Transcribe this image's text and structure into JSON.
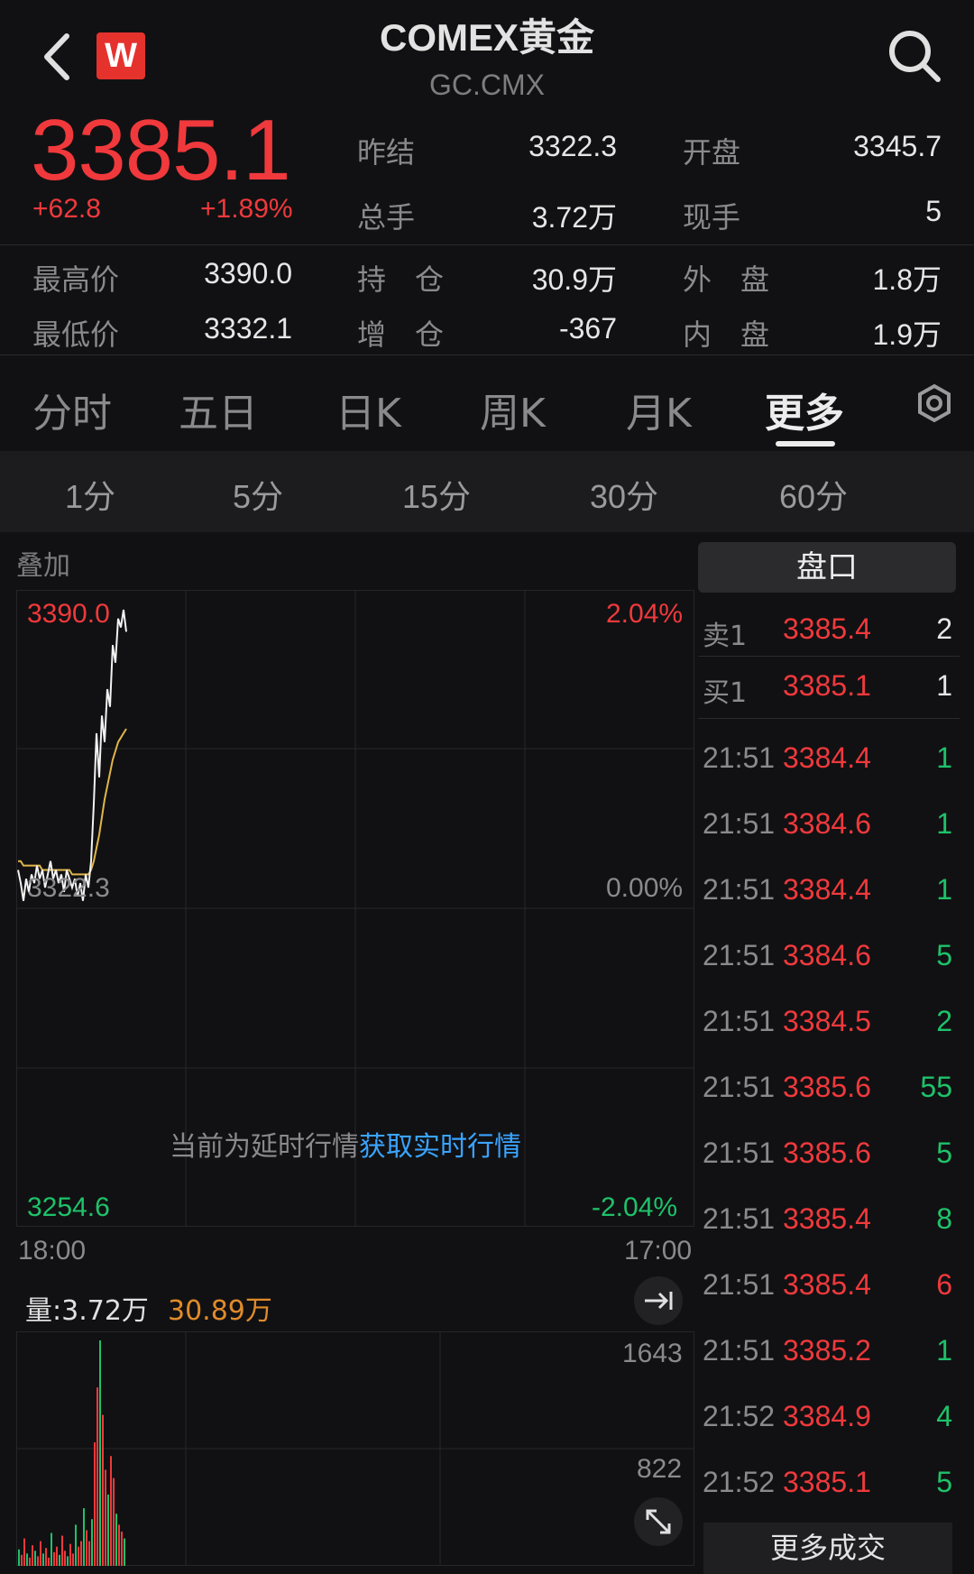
{
  "header": {
    "title": "COMEX黄金",
    "code": "GC.CMX",
    "logo_text": "W"
  },
  "quote": {
    "last": "3385.1",
    "change": "+62.8",
    "change_pct": "+1.89%",
    "stats": [
      {
        "label": "昨结",
        "value": "3322.3"
      },
      {
        "label": "开盘",
        "value": "3345.7"
      },
      {
        "label": "总手",
        "value": "3.72万"
      },
      {
        "label": "现手",
        "value": "5"
      },
      {
        "label": "最高价",
        "value": "3390.0"
      },
      {
        "label": "持　仓",
        "value": "30.9万"
      },
      {
        "label": "外　盘",
        "value": "1.8万"
      },
      {
        "label": "最低价",
        "value": "3332.1"
      },
      {
        "label": "增　仓",
        "value": "-367"
      },
      {
        "label": "内　盘",
        "value": "1.9万"
      }
    ]
  },
  "tabs": [
    "分时",
    "五日",
    "日K",
    "周K",
    "月K",
    "更多"
  ],
  "active_tab": "更多",
  "subtabs": [
    "1分",
    "5分",
    "15分",
    "30分",
    "60分"
  ],
  "chart": {
    "overlay_label": "叠加",
    "y_high": "3390.0",
    "y_mid": "3322.3",
    "y_low": "3254.6",
    "pct_high": "2.04%",
    "pct_mid": "0.00%",
    "pct_low": "-2.04%",
    "x_start": "18:00",
    "x_end": "17:00",
    "delay_notice": "当前为延时行情",
    "delay_link": "获取实时行情",
    "volume_label": "量:3.72万",
    "open_interest": "30.89万",
    "vol_max": "1643",
    "vol_mid": "822"
  },
  "chart_data": {
    "type": "line",
    "title": "",
    "xlabel": "",
    "ylabel": "",
    "ylim": [
      3254.6,
      3390.0
    ],
    "x_ticks": [
      "18:00",
      "17:00"
    ],
    "series": [
      {
        "values": [
          3331,
          3328,
          3324,
          3329,
          3326,
          3330,
          3328,
          3332,
          3329,
          3331,
          3327,
          3330,
          3333,
          3329,
          3331,
          3328,
          3330,
          3326,
          3331,
          3329,
          3327,
          3329,
          3325,
          3328,
          3324,
          3330,
          3327,
          3333,
          3346,
          3362,
          3352,
          3366,
          3360,
          3372,
          3368,
          3382,
          3378,
          3388,
          3386,
          3390,
          3385
        ]
      },
      {
        "values": [
          3333,
          3333,
          3332,
          3332,
          3332,
          3332,
          3332,
          3332,
          3332,
          3331,
          3331,
          3331,
          3331,
          3331,
          3331,
          3331,
          3331,
          3331,
          3331,
          3331,
          3330,
          3330,
          3330,
          3330,
          3330,
          3330,
          3330,
          3331,
          3333,
          3336,
          3339,
          3343,
          3347,
          3350,
          3353,
          3356,
          3358,
          3360,
          3361,
          3362,
          3363
        ]
      }
    ]
  },
  "volume_data": [
    120,
    80,
    200,
    90,
    60,
    150,
    110,
    70,
    180,
    90,
    130,
    60,
    240,
    100,
    140,
    80,
    220,
    110,
    70,
    160,
    90,
    300,
    140,
    180,
    420,
    260,
    180,
    340,
    900,
    1300,
    1643,
    1100,
    700,
    520,
    800,
    640,
    380,
    300,
    250,
    200
  ],
  "orderbook": {
    "title": "盘口",
    "asks": [
      {
        "label": "卖1",
        "price": "3385.4",
        "qty": "2"
      }
    ],
    "bids": [
      {
        "label": "买1",
        "price": "3385.1",
        "qty": "1"
      }
    ]
  },
  "trades": [
    {
      "time": "21:51",
      "price": "3384.4",
      "qty": "1",
      "side": "buy"
    },
    {
      "time": "21:51",
      "price": "3384.6",
      "qty": "1",
      "side": "buy"
    },
    {
      "time": "21:51",
      "price": "3384.4",
      "qty": "1",
      "side": "buy"
    },
    {
      "time": "21:51",
      "price": "3384.6",
      "qty": "5",
      "side": "buy"
    },
    {
      "time": "21:51",
      "price": "3384.5",
      "qty": "2",
      "side": "buy"
    },
    {
      "time": "21:51",
      "price": "3385.6",
      "qty": "55",
      "side": "buy"
    },
    {
      "time": "21:51",
      "price": "3385.6",
      "qty": "5",
      "side": "buy"
    },
    {
      "time": "21:51",
      "price": "3385.4",
      "qty": "8",
      "side": "buy"
    },
    {
      "time": "21:51",
      "price": "3385.4",
      "qty": "6",
      "side": "sell"
    },
    {
      "time": "21:51",
      "price": "3385.2",
      "qty": "1",
      "side": "buy"
    },
    {
      "time": "21:52",
      "price": "3384.9",
      "qty": "4",
      "side": "buy"
    },
    {
      "time": "21:52",
      "price": "3385.1",
      "qty": "5",
      "side": "buy"
    }
  ],
  "more_trades_label": "更多成交",
  "colors": {
    "up": "#f0393c",
    "down": "#1ec26a",
    "avg_line": "#e0b64a",
    "background": "#111113"
  }
}
